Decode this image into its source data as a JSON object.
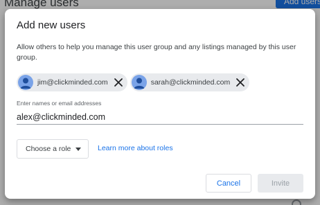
{
  "background": {
    "title": "Manage users",
    "add_button_label": "Add users"
  },
  "dialog": {
    "title": "Add new users",
    "description": "Allow others to help you manage this user group and any listings managed by this user group.",
    "chips": [
      {
        "email": "jim@clickminded.com",
        "avatar_icon": "person-avatar-icon",
        "remove_icon": "close-icon"
      },
      {
        "email": "sarah@clickminded.com",
        "avatar_icon": "person-avatar-icon",
        "remove_icon": "close-icon"
      }
    ],
    "input": {
      "label": "Enter names or email addresses",
      "value": "alex@clickminded.com"
    },
    "role_select": {
      "selected": "Choose a role",
      "icon": "caret-down-icon"
    },
    "learn_more_label": "Learn more about roles",
    "buttons": {
      "cancel_label": "Cancel",
      "invite_label": "Invite"
    }
  },
  "colors": {
    "accent": "#1a73e8",
    "chip_background": "#e8eaed",
    "avatar": "#7aa3e8",
    "disabled_text": "#9aa0a6"
  }
}
